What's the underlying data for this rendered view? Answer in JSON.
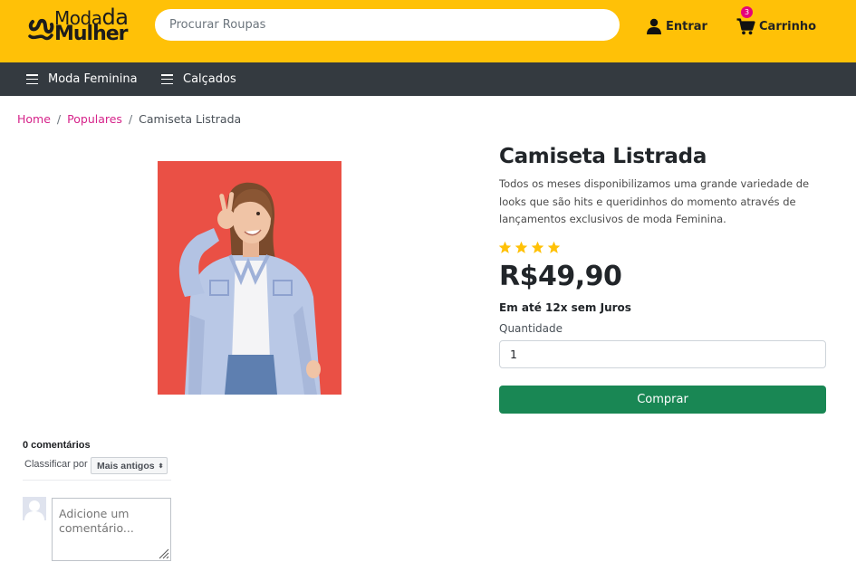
{
  "header": {
    "logo": {
      "line1": "Moda",
      "line1b": "da",
      "line2": "Mulher"
    },
    "search": {
      "placeholder": "Procurar Roupas"
    },
    "login_label": "Entrar",
    "cart_label": "Carrinho",
    "cart_count": "3",
    "accent_color": "#ffc107",
    "badge_color": "#e6007a"
  },
  "nav": {
    "items": [
      {
        "label": "Moda Feminina",
        "icon": "menu-icon"
      },
      {
        "label": "Calçados",
        "icon": "menu-icon"
      }
    ]
  },
  "breadcrumb": {
    "items": [
      {
        "label": "Home"
      },
      {
        "label": "Populares"
      },
      {
        "label": "Camiseta Listrada"
      }
    ],
    "separator": "/"
  },
  "product": {
    "title": "Camiseta Listrada",
    "description": "Todos os meses disponibilizamos uma grande variedade de looks que são hits e queridinhos do momento através de lançamentos exclusivos de moda Feminina.",
    "rating": 4,
    "price": "R$49,90",
    "installments": "Em até 12x sem Juros",
    "quantity_label": "Quantidade",
    "quantity_value": "1",
    "buy_label": "Comprar",
    "buy_color": "#198754"
  },
  "comments": {
    "count_label": "0 comentários",
    "sort_label": "Classificar por",
    "sort_value": "Mais antigos",
    "input_placeholder": "Adicione um comentário..."
  }
}
